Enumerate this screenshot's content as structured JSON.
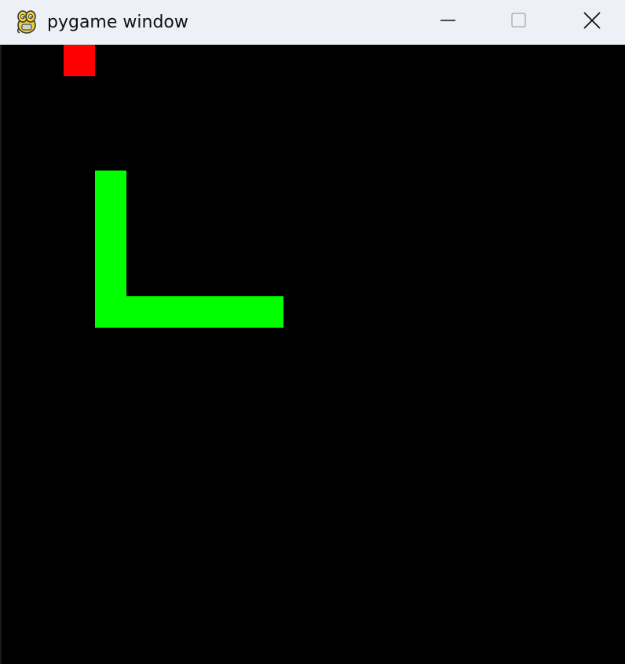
{
  "window": {
    "title": "pygame window",
    "app_icon": "pygame-snake-icon",
    "controls": {
      "minimize_icon": "minimize-icon",
      "maximize_icon": "maximize-icon",
      "close_icon": "close-icon"
    }
  },
  "game": {
    "background_color": "#000000",
    "snake_color": "#00ff00",
    "food_color": "#ff0000",
    "cell_size_px": 40,
    "food": {
      "col": 2,
      "row": 0
    },
    "snake": [
      {
        "col": 3,
        "row": 4
      },
      {
        "col": 3,
        "row": 5
      },
      {
        "col": 3,
        "row": 6
      },
      {
        "col": 3,
        "row": 7
      },
      {
        "col": 3,
        "row": 8
      },
      {
        "col": 4,
        "row": 8
      },
      {
        "col": 5,
        "row": 8
      },
      {
        "col": 6,
        "row": 8
      },
      {
        "col": 7,
        "row": 8
      },
      {
        "col": 8,
        "row": 8
      }
    ]
  }
}
